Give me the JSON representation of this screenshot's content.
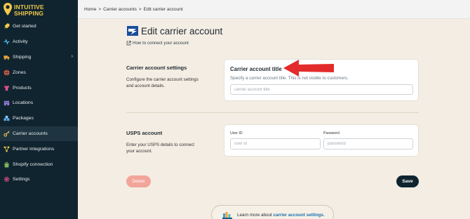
{
  "brand": {
    "name_line1": "INTUITIVE",
    "name_line2": "SHIPPING"
  },
  "sidebar": {
    "items": [
      {
        "label": "Get started",
        "icon": "rocket-icon"
      },
      {
        "label": "Activity",
        "icon": "activity-icon"
      },
      {
        "label": "Shipping",
        "icon": "truck-icon",
        "has_chevron": true
      },
      {
        "label": "Zones",
        "icon": "globe-icon"
      },
      {
        "label": "Products",
        "icon": "shirt-icon"
      },
      {
        "label": "Locations",
        "icon": "building-icon"
      },
      {
        "label": "Packages",
        "icon": "boxes-icon"
      },
      {
        "label": "Carrier accounts",
        "icon": "key-icon",
        "active": true
      },
      {
        "label": "Partner integrations",
        "icon": "network-icon"
      },
      {
        "label": "Shopify connection",
        "icon": "shopify-bag-icon"
      },
      {
        "label": "Settings",
        "icon": "gear-icon"
      }
    ]
  },
  "breadcrumb": {
    "items": [
      "Home",
      "Carrier accounts",
      "Edit carrier account"
    ],
    "separator": ">"
  },
  "page": {
    "title": "Edit carrier account",
    "help_link": "How to connect your account"
  },
  "sections": {
    "settings": {
      "title": "Carrier account settings",
      "description": "Configure the carrier account settings and account details.",
      "card_title": "Carrier account title",
      "card_help": "Specify a carrier account title. This is not visible to customers.",
      "input_placeholder": "carrier account title",
      "input_value": ""
    },
    "usps": {
      "title": "USPS account",
      "description": "Enter your USPS details to connect your account.",
      "user_id_label": "User ID",
      "user_id_placeholder": "user id",
      "password_label": "Password",
      "password_placeholder": "password"
    }
  },
  "actions": {
    "delete_label": "Delete",
    "save_label": "Save"
  },
  "footer": {
    "learn_prefix": "Learn more about ",
    "learn_link": "carrier account settings."
  },
  "colors": {
    "sidebar_bg": "#10242f",
    "brand_yellow": "#f2c94c",
    "page_bg": "#f4ede3",
    "annotation_arrow": "#e32b2b",
    "delete_button": "#f3a49a",
    "save_button": "#10242f",
    "link": "#1a6fb0"
  }
}
